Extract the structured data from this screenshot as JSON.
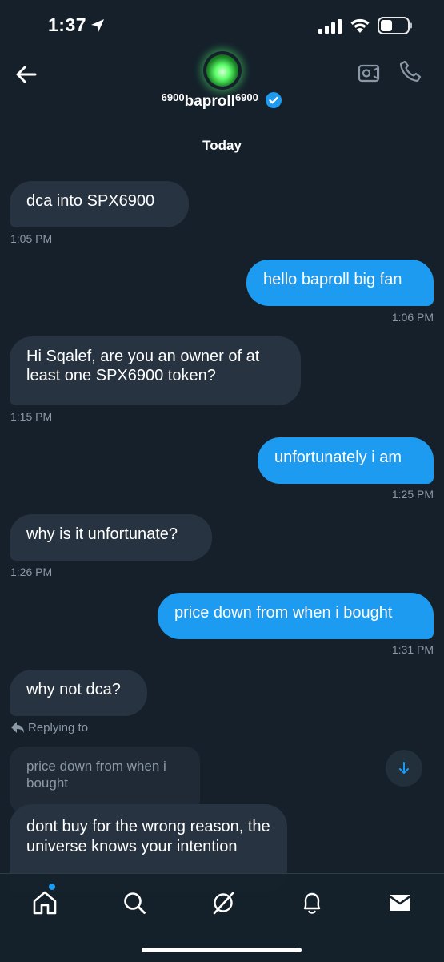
{
  "status": {
    "time": "1:37"
  },
  "header": {
    "name_prefix": "6900",
    "name_main": "baproll",
    "name_suffix": "6900"
  },
  "day_label": "Today",
  "messages": [
    {
      "text": "dca into SPX6900",
      "time": "1:05 PM"
    },
    {
      "text": "hello baproll big fan",
      "time": "1:06 PM"
    },
    {
      "text": "Hi Sqalef, are you an owner of at least one SPX6900 token?",
      "time": "1:15 PM"
    },
    {
      "text": "unfortunately i am",
      "time": "1:25 PM"
    },
    {
      "text": "why is it unfortunate?",
      "time": "1:26 PM"
    },
    {
      "text": "price down from when i bought",
      "time": "1:31 PM"
    },
    {
      "text": "why not dca?"
    },
    {
      "text": "dont buy for the wrong reason, the universe knows your intention"
    }
  ],
  "reply": {
    "label": "Replying to",
    "quoted_text": "price down from when i bought"
  },
  "colors": {
    "background": "#15202b",
    "incoming_bubble": "#273340",
    "outgoing_bubble": "#1d9bf0",
    "timestamp": "#8b98a5"
  },
  "icons": [
    "location-arrow-icon",
    "signal-icon",
    "wifi-icon",
    "battery-icon",
    "back-arrow-icon",
    "verified-badge-icon",
    "video-call-icon",
    "phone-icon",
    "reply-arrow-icon",
    "scroll-down-icon",
    "home-icon",
    "search-icon",
    "grok-icon",
    "notifications-icon",
    "messages-icon"
  ]
}
